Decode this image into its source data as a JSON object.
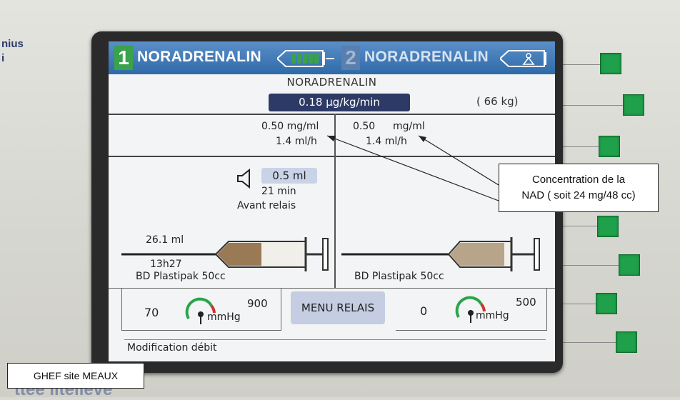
{
  "device": {
    "brand_fragment_1": "nius",
    "brand_fragment_2": "i",
    "bottom_fragment": "ttee iiteiieve"
  },
  "header": {
    "ch1": {
      "number": "1",
      "drug": "NORADRENALIN"
    },
    "ch2": {
      "number": "2",
      "drug": "NORADRENALIN"
    }
  },
  "main": {
    "drug_name": "NORADRENALIN",
    "rate": "0.18 µg/kg/min",
    "weight": "( 66 kg)"
  },
  "left": {
    "concentration": "0.50 mg/ml",
    "flow": "1.4 ml/h",
    "alarm_volume": "0.5 ml",
    "alarm_time": "21 min",
    "alarm_label": "Avant relais",
    "syringe_volume": "26.1 ml",
    "syringe_time": "13h27",
    "syringe_model": "BD Plastipak 50cc",
    "pressure_value": "70",
    "pressure_limit": "900",
    "pressure_unit": "mmHg"
  },
  "right": {
    "concentration_value": "0.50",
    "concentration_unit": "mg/ml",
    "flow": "1.4 ml/h",
    "syringe_model": "BD Plastipak 50cc",
    "pressure_value": "0",
    "pressure_limit": "500",
    "pressure_unit": "mmHg"
  },
  "menu_relais": "MENU RELAIS",
  "status": "Modification débit",
  "annotation": {
    "line1": "Concentration de la",
    "line2": "NAD ( soit 24 mg/48 cc)"
  },
  "credit": "GHEF site MEAUX",
  "colors": {
    "header_blue": "#2f6aa8",
    "active_green": "#3aa24a",
    "rate_box": "#2d3a66",
    "button_green": "#1fa04a"
  }
}
